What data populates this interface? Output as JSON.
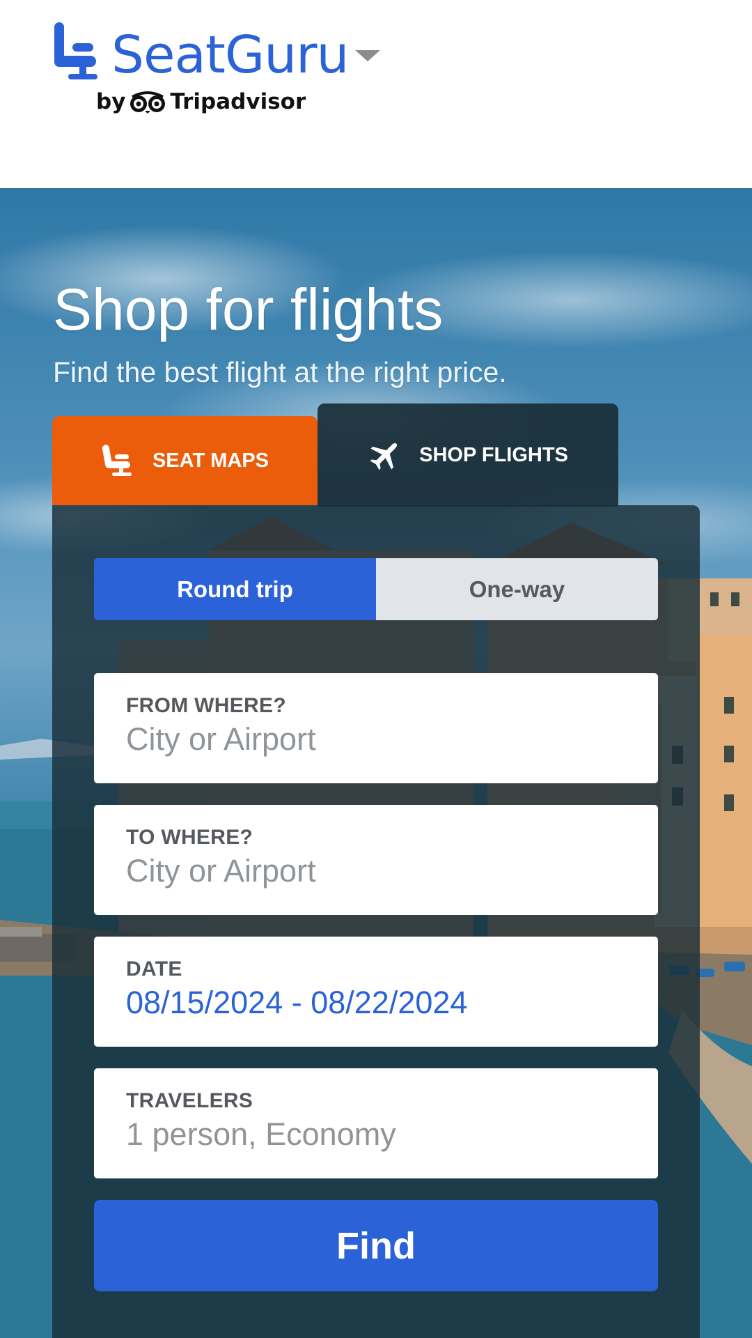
{
  "header": {
    "brand": "SeatGuru",
    "byline_prefix": "by",
    "byline_brand": "Tripadvisor",
    "brand_color": "#2b62d8"
  },
  "hero": {
    "title": "Shop for flights",
    "subtitle": "Find the best flight at the right price."
  },
  "tabs": [
    {
      "label": "SEAT MAPS",
      "icon": "seat-icon",
      "active": false,
      "color": "#eb5c0b"
    },
    {
      "label": "SHOP FLIGHTS",
      "icon": "airplane-icon",
      "active": true
    }
  ],
  "trip_type": {
    "options": [
      "Round trip",
      "One-way"
    ],
    "selected": "Round trip"
  },
  "fields": {
    "from": {
      "label": "FROM WHERE?",
      "placeholder": "City or Airport"
    },
    "to": {
      "label": "TO WHERE?",
      "placeholder": "City or Airport"
    },
    "date": {
      "label": "DATE",
      "value": "08/15/2024 - 08/22/2024"
    },
    "travelers": {
      "label": "TRAVELERS",
      "value": "1 person, Economy"
    }
  },
  "find_button": {
    "label": "Find",
    "color": "#2b62d8"
  }
}
